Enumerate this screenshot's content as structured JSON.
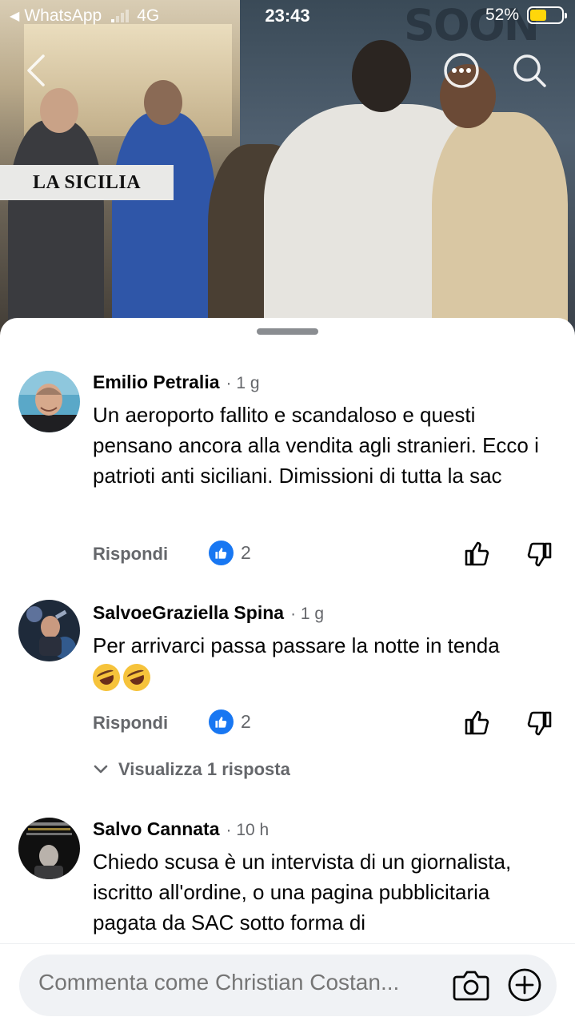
{
  "status_bar": {
    "back_app": "WhatsApp",
    "network": "4G",
    "time": "23:43",
    "battery": "52%",
    "battery_level": 0.52
  },
  "video": {
    "source_badge": "LA SICILIA",
    "background_sign": "SOON"
  },
  "icons": {
    "back": "chevron-left-icon",
    "more": "more-horizontal-icon",
    "search": "search-icon",
    "like": "thumbs-up-icon",
    "dislike": "thumbs-down-icon",
    "camera": "camera-icon",
    "add": "plus-circle-icon"
  },
  "colors": {
    "like_blue": "#1877f2",
    "secondary_text": "#65676b",
    "battery_yellow": "#ffd60a"
  },
  "comments": [
    {
      "author": "Emilio Petralia",
      "time": "· 1 g",
      "text": "Un aeroporto fallito e scandaloso e questi pensano ancora alla vendita agli stranieri. Ecco i patrioti anti siciliani. Dimissioni di tutta la sac",
      "reply_label": "Rispondi",
      "likes": "2"
    },
    {
      "author": "SalvoeGraziella Spina",
      "time": "· 1 g",
      "text": "Per arrivarci passa passare la notte in tenda",
      "emojis": "🤣🤣",
      "reply_label": "Rispondi",
      "likes": "2",
      "view_replies": "Visualizza 1 risposta"
    },
    {
      "author": "Salvo Cannata",
      "time": "· 10 h",
      "text": "Chiedo scusa è un intervista di un giornalista, iscritto all'ordine, o una pagina pubblicitaria pagata da SAC sotto forma di"
    }
  ],
  "composer": {
    "placeholder": "Commenta come Christian Costan..."
  }
}
